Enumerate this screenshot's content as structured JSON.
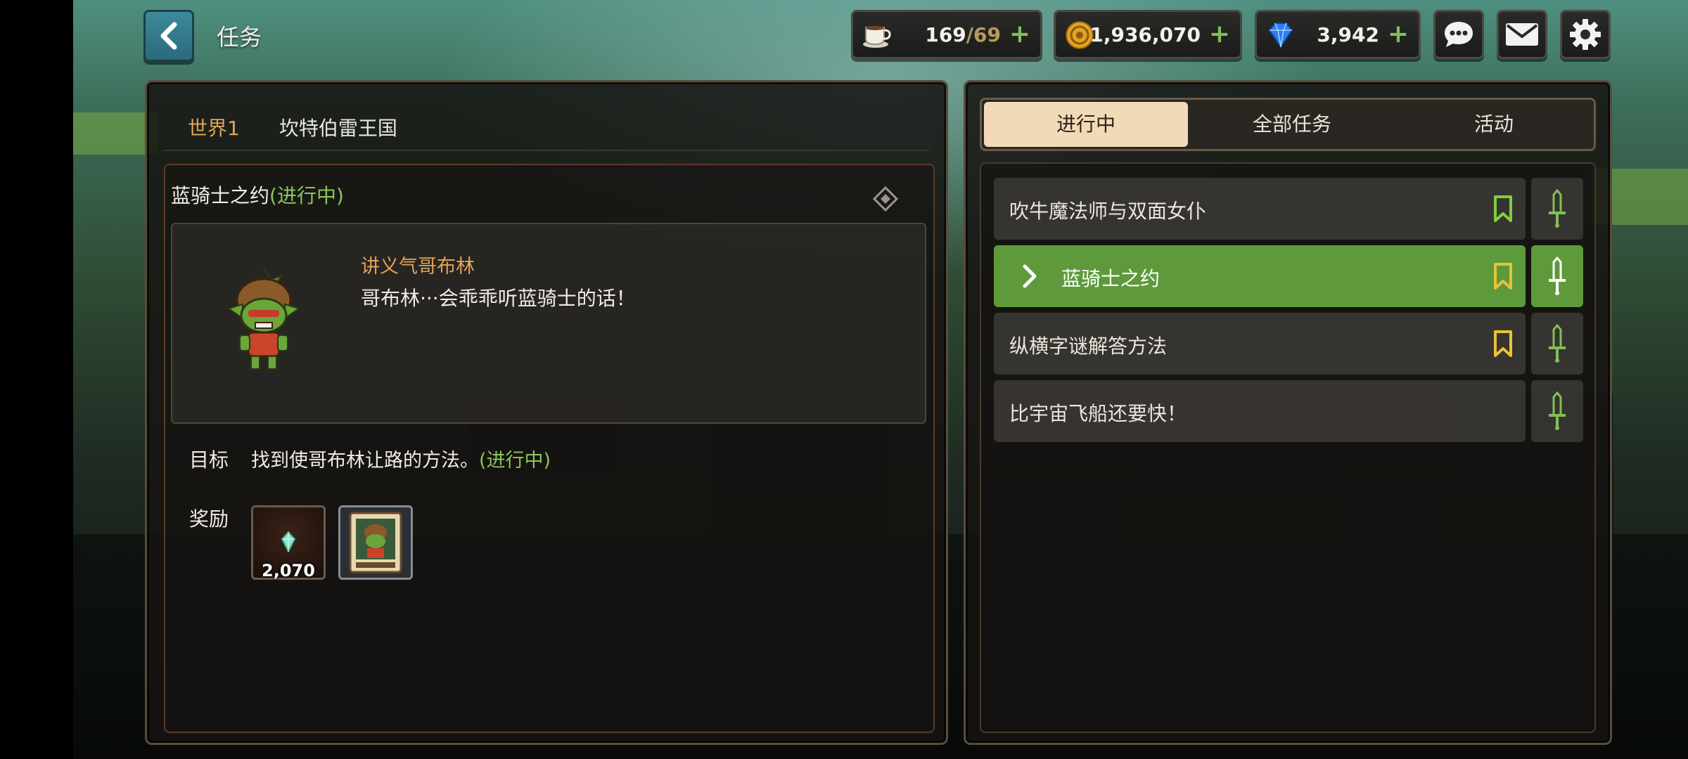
{
  "header": {
    "title": "任务"
  },
  "resources": {
    "stamina": {
      "icon": "coffee-cup-icon",
      "current": "169",
      "max": "69"
    },
    "gold": {
      "icon": "gold-coin-icon",
      "value": "1,936,070"
    },
    "gems": {
      "icon": "blue-gem-icon",
      "value": "3,942"
    }
  },
  "top_buttons": [
    "chat-icon",
    "mail-icon",
    "gear-icon"
  ],
  "quest_detail": {
    "breadcrumb": {
      "world": "世界1",
      "region": "坎特伯雷王国"
    },
    "quest_name": "蓝骑士之约",
    "quest_status": "(进行中)",
    "npc_name": "讲义气哥布林",
    "npc_dialogue": "哥布林···会乖乖听蓝骑士的话！",
    "goal_label": "目标",
    "goal_text": "找到使哥布林让路的方法。",
    "goal_status": "(进行中)",
    "reward_label": "奖励",
    "rewards": [
      {
        "icon": "crystal-icon",
        "amount": "2,070"
      },
      {
        "icon": "goblin-card-icon"
      }
    ]
  },
  "tabs": [
    {
      "label": "进行中",
      "active": true
    },
    {
      "label": "全部任务",
      "active": false
    },
    {
      "label": "活动",
      "active": false
    }
  ],
  "quest_list": [
    {
      "label": "吹牛魔法师与双面女仆",
      "bookmark": "green",
      "selected": false
    },
    {
      "label": "蓝骑士之约",
      "bookmark": "yellow",
      "selected": true
    },
    {
      "label": "纵横字谜解答方法",
      "bookmark": "yellow",
      "selected": false
    },
    {
      "label": "比宇宙飞船还要快！",
      "bookmark": "none",
      "selected": false
    }
  ],
  "colors": {
    "accent_green": "#5e9a3b",
    "status_green": "#8bc65c",
    "world_orange": "#e0a457",
    "tab_active": "#f2d9b8"
  }
}
